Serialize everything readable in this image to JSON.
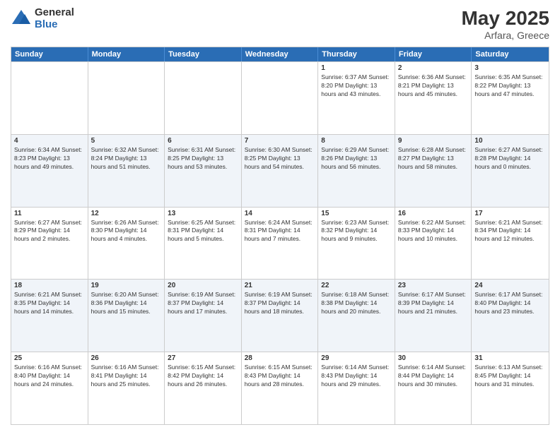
{
  "header": {
    "logo_general": "General",
    "logo_blue": "Blue",
    "month_year": "May 2025",
    "location": "Arfara, Greece"
  },
  "days_of_week": [
    "Sunday",
    "Monday",
    "Tuesday",
    "Wednesday",
    "Thursday",
    "Friday",
    "Saturday"
  ],
  "rows": [
    {
      "alt": false,
      "cells": [
        {
          "day": "",
          "info": ""
        },
        {
          "day": "",
          "info": ""
        },
        {
          "day": "",
          "info": ""
        },
        {
          "day": "",
          "info": ""
        },
        {
          "day": "1",
          "info": "Sunrise: 6:37 AM\nSunset: 8:20 PM\nDaylight: 13 hours\nand 43 minutes."
        },
        {
          "day": "2",
          "info": "Sunrise: 6:36 AM\nSunset: 8:21 PM\nDaylight: 13 hours\nand 45 minutes."
        },
        {
          "day": "3",
          "info": "Sunrise: 6:35 AM\nSunset: 8:22 PM\nDaylight: 13 hours\nand 47 minutes."
        }
      ]
    },
    {
      "alt": true,
      "cells": [
        {
          "day": "4",
          "info": "Sunrise: 6:34 AM\nSunset: 8:23 PM\nDaylight: 13 hours\nand 49 minutes."
        },
        {
          "day": "5",
          "info": "Sunrise: 6:32 AM\nSunset: 8:24 PM\nDaylight: 13 hours\nand 51 minutes."
        },
        {
          "day": "6",
          "info": "Sunrise: 6:31 AM\nSunset: 8:25 PM\nDaylight: 13 hours\nand 53 minutes."
        },
        {
          "day": "7",
          "info": "Sunrise: 6:30 AM\nSunset: 8:25 PM\nDaylight: 13 hours\nand 54 minutes."
        },
        {
          "day": "8",
          "info": "Sunrise: 6:29 AM\nSunset: 8:26 PM\nDaylight: 13 hours\nand 56 minutes."
        },
        {
          "day": "9",
          "info": "Sunrise: 6:28 AM\nSunset: 8:27 PM\nDaylight: 13 hours\nand 58 minutes."
        },
        {
          "day": "10",
          "info": "Sunrise: 6:27 AM\nSunset: 8:28 PM\nDaylight: 14 hours\nand 0 minutes."
        }
      ]
    },
    {
      "alt": false,
      "cells": [
        {
          "day": "11",
          "info": "Sunrise: 6:27 AM\nSunset: 8:29 PM\nDaylight: 14 hours\nand 2 minutes."
        },
        {
          "day": "12",
          "info": "Sunrise: 6:26 AM\nSunset: 8:30 PM\nDaylight: 14 hours\nand 4 minutes."
        },
        {
          "day": "13",
          "info": "Sunrise: 6:25 AM\nSunset: 8:31 PM\nDaylight: 14 hours\nand 5 minutes."
        },
        {
          "day": "14",
          "info": "Sunrise: 6:24 AM\nSunset: 8:31 PM\nDaylight: 14 hours\nand 7 minutes."
        },
        {
          "day": "15",
          "info": "Sunrise: 6:23 AM\nSunset: 8:32 PM\nDaylight: 14 hours\nand 9 minutes."
        },
        {
          "day": "16",
          "info": "Sunrise: 6:22 AM\nSunset: 8:33 PM\nDaylight: 14 hours\nand 10 minutes."
        },
        {
          "day": "17",
          "info": "Sunrise: 6:21 AM\nSunset: 8:34 PM\nDaylight: 14 hours\nand 12 minutes."
        }
      ]
    },
    {
      "alt": true,
      "cells": [
        {
          "day": "18",
          "info": "Sunrise: 6:21 AM\nSunset: 8:35 PM\nDaylight: 14 hours\nand 14 minutes."
        },
        {
          "day": "19",
          "info": "Sunrise: 6:20 AM\nSunset: 8:36 PM\nDaylight: 14 hours\nand 15 minutes."
        },
        {
          "day": "20",
          "info": "Sunrise: 6:19 AM\nSunset: 8:37 PM\nDaylight: 14 hours\nand 17 minutes."
        },
        {
          "day": "21",
          "info": "Sunrise: 6:19 AM\nSunset: 8:37 PM\nDaylight: 14 hours\nand 18 minutes."
        },
        {
          "day": "22",
          "info": "Sunrise: 6:18 AM\nSunset: 8:38 PM\nDaylight: 14 hours\nand 20 minutes."
        },
        {
          "day": "23",
          "info": "Sunrise: 6:17 AM\nSunset: 8:39 PM\nDaylight: 14 hours\nand 21 minutes."
        },
        {
          "day": "24",
          "info": "Sunrise: 6:17 AM\nSunset: 8:40 PM\nDaylight: 14 hours\nand 23 minutes."
        }
      ]
    },
    {
      "alt": false,
      "cells": [
        {
          "day": "25",
          "info": "Sunrise: 6:16 AM\nSunset: 8:40 PM\nDaylight: 14 hours\nand 24 minutes."
        },
        {
          "day": "26",
          "info": "Sunrise: 6:16 AM\nSunset: 8:41 PM\nDaylight: 14 hours\nand 25 minutes."
        },
        {
          "day": "27",
          "info": "Sunrise: 6:15 AM\nSunset: 8:42 PM\nDaylight: 14 hours\nand 26 minutes."
        },
        {
          "day": "28",
          "info": "Sunrise: 6:15 AM\nSunset: 8:43 PM\nDaylight: 14 hours\nand 28 minutes."
        },
        {
          "day": "29",
          "info": "Sunrise: 6:14 AM\nSunset: 8:43 PM\nDaylight: 14 hours\nand 29 minutes."
        },
        {
          "day": "30",
          "info": "Sunrise: 6:14 AM\nSunset: 8:44 PM\nDaylight: 14 hours\nand 30 minutes."
        },
        {
          "day": "31",
          "info": "Sunrise: 6:13 AM\nSunset: 8:45 PM\nDaylight: 14 hours\nand 31 minutes."
        }
      ]
    }
  ]
}
